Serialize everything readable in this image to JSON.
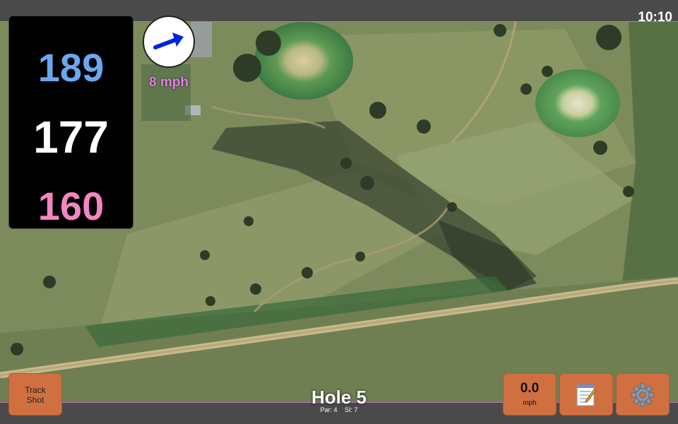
{
  "status": {
    "clock": "10:10"
  },
  "distances": {
    "back": "189",
    "middle": "177",
    "front": "160"
  },
  "wind": {
    "speed": "8 mph",
    "icon": "arrow-northeast-icon"
  },
  "hole": {
    "title": "Hole 5",
    "par": "Par: 4",
    "stroke_index": "SI: 7"
  },
  "buttons": {
    "track_line1": "Track",
    "track_line2": "Shot",
    "speed_value": "0.0",
    "speed_unit": "mph",
    "notes_icon": "notepad-icon",
    "settings_icon": "gear-icon"
  },
  "colors": {
    "back_distance": "#6aa7ee",
    "middle_distance": "#ffffff",
    "front_distance": "#f186c0",
    "button": "#d07040",
    "wind_text": "#e77fe8"
  }
}
